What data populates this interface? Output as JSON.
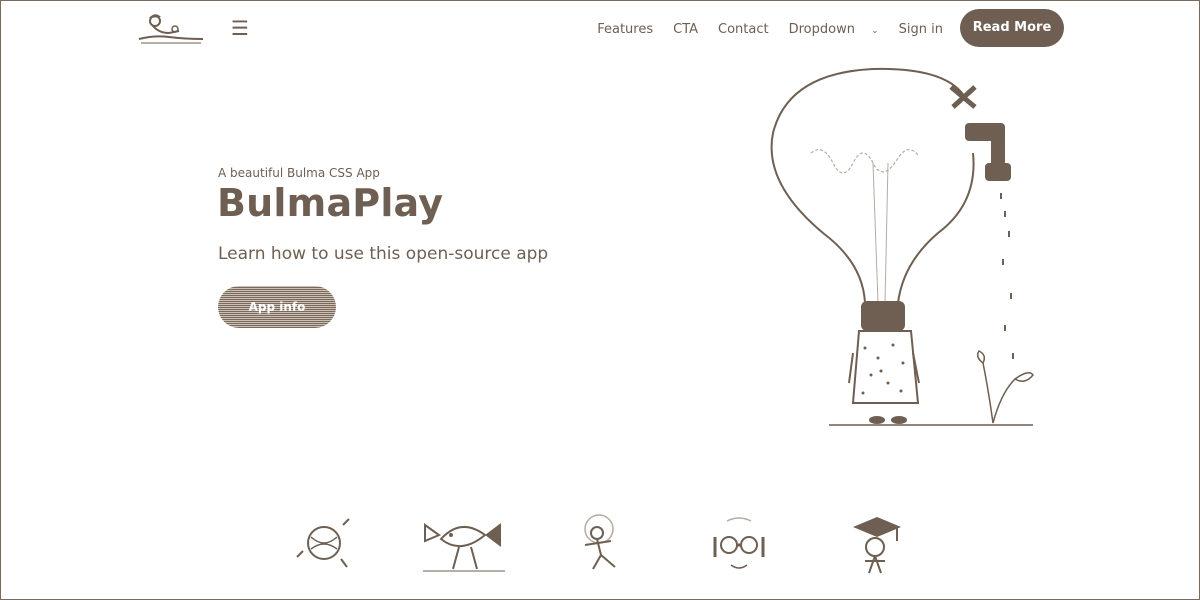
{
  "nav": {
    "logo_icon": "person-reading-logo-icon",
    "menu_icon": "hamburger-menu-icon",
    "menu_glyph": "☰",
    "links": [
      "Features",
      "CTA",
      "Contact",
      "Dropdown",
      "Sign in"
    ],
    "dropdown_chevron": "⌄",
    "read_more": "Read More"
  },
  "hero": {
    "subtitle": "A beautiful Bulma CSS App",
    "title": "BulmaPlay",
    "description": "Learn how to use this open-source app",
    "button": "App info",
    "illustration": "lightbulb-faucet-plant-illustration"
  },
  "features_icons": [
    "ball-of-yarn-icon",
    "fish-walking-icon",
    "dancing-figure-icon",
    "glasses-face-icon",
    "graduate-cap-icon"
  ],
  "colors": {
    "brand": "#6e5f52",
    "background": "#ffffff"
  }
}
